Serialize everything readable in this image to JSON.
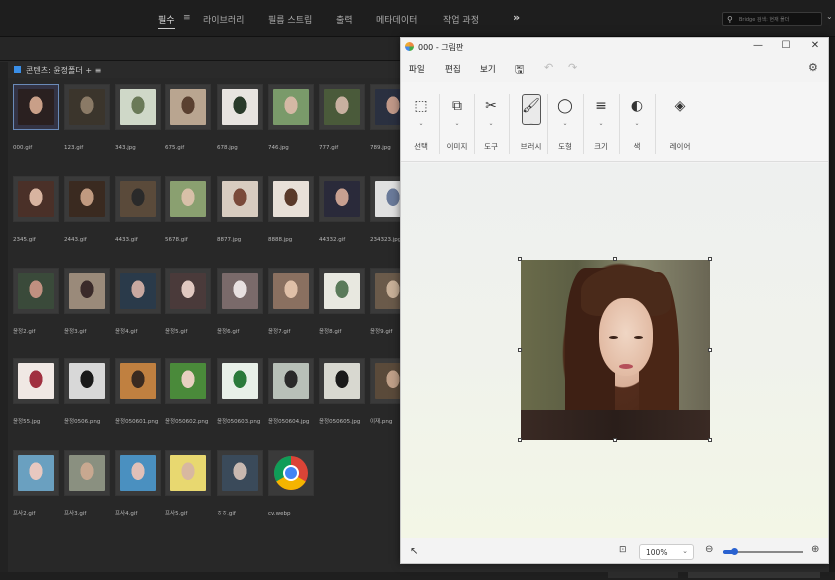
{
  "bridge": {
    "workspaces": [
      {
        "label": "필수",
        "active": true
      },
      {
        "label": "라이브러리",
        "active": false
      },
      {
        "label": "필름 스트립",
        "active": false
      },
      {
        "label": "출력",
        "active": false
      },
      {
        "label": "메타데이터",
        "active": false
      },
      {
        "label": "작업 과정",
        "active": false
      }
    ],
    "active_menu_icon": "≡",
    "more_label": "»",
    "search_placeholder": "Bridge 검색: 현재 폴더",
    "content_title": "콘텐츠: 윤정폴더",
    "content_plus": "+",
    "content_menu": "≡"
  },
  "files": [
    {
      "name": "000.gif",
      "selected": true,
      "colors": [
        "#2a2020",
        "#c99f88"
      ]
    },
    {
      "name": "123.gif",
      "selected": false,
      "colors": [
        "#3b352c",
        "#8a7a66"
      ]
    },
    {
      "name": "343.jpg",
      "selected": false,
      "colors": [
        "#cfd8c8",
        "#6a7a58"
      ]
    },
    {
      "name": "675.gif",
      "selected": false,
      "colors": [
        "#b9a590",
        "#5a4030"
      ]
    },
    {
      "name": "678.jpg",
      "selected": false,
      "colors": [
        "#e8e4e0",
        "#2a3a2a"
      ]
    },
    {
      "name": "746.jpg",
      "selected": false,
      "colors": [
        "#7a9a6a",
        "#d4b8a4"
      ]
    },
    {
      "name": "777.gif",
      "selected": false,
      "colors": [
        "#4a5a3a",
        "#c8b0a0"
      ]
    },
    {
      "name": "789.jpg",
      "selected": false,
      "colors": [
        "#2a3040",
        "#c09888"
      ]
    },
    {
      "name": "2345.gif",
      "selected": false,
      "colors": [
        "#4a3028",
        "#d8b4a0"
      ]
    },
    {
      "name": "2443.gif",
      "selected": false,
      "colors": [
        "#3a2a20",
        "#c09a80"
      ]
    },
    {
      "name": "4433.gif",
      "selected": false,
      "colors": [
        "#5a4a3a",
        "#2a2a2a"
      ]
    },
    {
      "name": "5678.gif",
      "selected": false,
      "colors": [
        "#8aa070",
        "#d8c0a8"
      ]
    },
    {
      "name": "8877.jpg",
      "selected": false,
      "colors": [
        "#d8ccc0",
        "#7a4a3a"
      ]
    },
    {
      "name": "8888.jpg",
      "selected": false,
      "colors": [
        "#e8e0d8",
        "#5a3a2a"
      ]
    },
    {
      "name": "44332.gif",
      "selected": false,
      "colors": [
        "#2a2a3a",
        "#c8a090"
      ]
    },
    {
      "name": "234323.jpg",
      "selected": false,
      "colors": [
        "#e0e0e0",
        "#6a7a9a"
      ]
    },
    {
      "name": "윤정2.gif",
      "selected": false,
      "colors": [
        "#3a4a3a",
        "#c09080"
      ]
    },
    {
      "name": "윤정3.gif",
      "selected": false,
      "colors": [
        "#9a8a7a",
        "#3a2a2a"
      ]
    },
    {
      "name": "윤정4.gif",
      "selected": false,
      "colors": [
        "#2a3a4a",
        "#c8a8a0"
      ]
    },
    {
      "name": "윤정5.gif",
      "selected": false,
      "colors": [
        "#4a3a3a",
        "#e0c8c0"
      ]
    },
    {
      "name": "윤정6.gif",
      "selected": false,
      "colors": [
        "#7a6a6a",
        "#e8e0e0"
      ]
    },
    {
      "name": "윤정7.gif",
      "selected": false,
      "colors": [
        "#8a7060",
        "#e0c0a8"
      ]
    },
    {
      "name": "윤정8.gif",
      "selected": false,
      "colors": [
        "#e8e8e0",
        "#5a7a5a"
      ]
    },
    {
      "name": "윤정9.gif",
      "selected": false,
      "colors": [
        "#6a5a4a",
        "#c8b098"
      ]
    },
    {
      "name": "윤정55.jpg",
      "selected": false,
      "colors": [
        "#f0e8e4",
        "#a03040"
      ]
    },
    {
      "name": "윤정0506.png",
      "selected": false,
      "colors": [
        "#d8d8d8",
        "#1a1a1a"
      ]
    },
    {
      "name": "윤정050601.png",
      "selected": false,
      "colors": [
        "#c08040",
        "#3a2a20"
      ]
    },
    {
      "name": "윤정050602.png",
      "selected": false,
      "colors": [
        "#4a8a3a",
        "#e8d0c0"
      ]
    },
    {
      "name": "윤정050603.png",
      "selected": false,
      "colors": [
        "#e8f0e8",
        "#2a7a3a"
      ]
    },
    {
      "name": "윤정050604.jpg",
      "selected": false,
      "colors": [
        "#b8c0b8",
        "#2a2a2a"
      ]
    },
    {
      "name": "윤정050605.jpg",
      "selected": false,
      "colors": [
        "#d8d8d0",
        "#1a1a1a"
      ]
    },
    {
      "name": "이재.png",
      "selected": false,
      "colors": [
        "#5a4a3a",
        "#c0a088"
      ]
    },
    {
      "name": "프사2.gif",
      "selected": false,
      "colors": [
        "#6aa0c0",
        "#e8c8c0"
      ]
    },
    {
      "name": "프사3.gif",
      "selected": false,
      "colors": [
        "#8a9080",
        "#c8a890"
      ]
    },
    {
      "name": "프사4.gif",
      "selected": false,
      "colors": [
        "#4a90c0",
        "#e0c0b8"
      ]
    },
    {
      "name": "프사5.gif",
      "selected": false,
      "colors": [
        "#e8d870",
        "#d8b8a0"
      ]
    },
    {
      "name": "ㅎㅎ.gif",
      "selected": false,
      "colors": [
        "#3a4a5a",
        "#c8b8b0"
      ]
    },
    {
      "name": "cv.webp",
      "selected": false,
      "colors": [
        "chrome",
        "chrome"
      ]
    }
  ],
  "paint": {
    "title": "000 - 그림판",
    "menus": [
      "파일",
      "편집",
      "보기"
    ],
    "save_icon": "🖫",
    "undo_icon": "↶",
    "redo_icon": "↷",
    "settings_icon": "⚙",
    "win_min": "—",
    "win_max": "☐",
    "win_close": "✕",
    "ribbon": [
      {
        "label": "선택",
        "icon": "⬚"
      },
      {
        "label": "이미지",
        "icon": "⧉"
      },
      {
        "label": "도구",
        "icon": "✂"
      },
      {
        "label": "브러시",
        "icon": "🖌"
      },
      {
        "label": "도형",
        "icon": "◯"
      },
      {
        "label": "크기",
        "icon": "≡"
      },
      {
        "label": "색",
        "icon": "◐"
      },
      {
        "label": "레이어",
        "icon": "◈"
      }
    ],
    "zoom_value": "100%",
    "zoom_fraction": 0.14,
    "zoom_out_icon": "⊖",
    "zoom_in_icon": "⊕",
    "cursor_icon": "↖",
    "fit_icon": "⊡",
    "dropdown_icon": "⌄"
  }
}
